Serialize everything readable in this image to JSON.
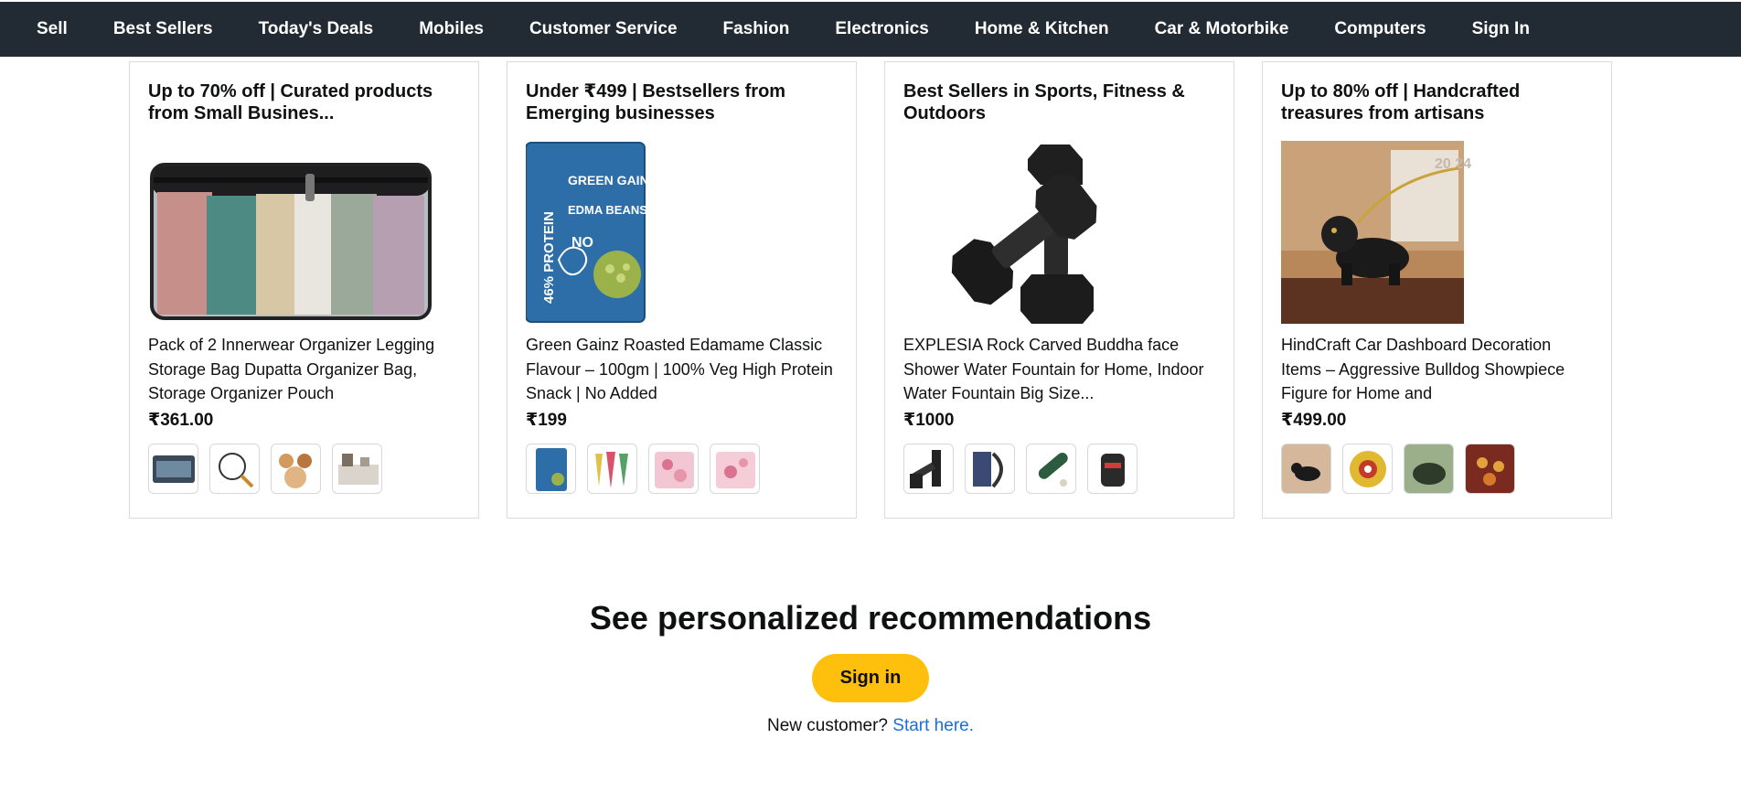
{
  "nav": {
    "items": [
      "Sell",
      "Best Sellers",
      "Today's Deals",
      "Mobiles",
      "Customer Service",
      "Fashion",
      "Electronics",
      "Home & Kitchen",
      "Car & Motorbike",
      "Computers",
      "Sign In"
    ]
  },
  "cards": [
    {
      "title": "Up to 70% off | Curated products from Small Busines...",
      "description": "Pack of 2 Innerwear Organizer Legging Storage Bag Dupatta Organizer Bag, Storage Organizer Pouch",
      "price": "₹361.00",
      "image_icon": "organizer-bag-image"
    },
    {
      "title": "Under ₹499 | Bestsellers from Emerging businesses",
      "description": "Green Gainz Roasted Edamame Classic Flavour – 100gm | 100% Veg High Protein Snack | No Added",
      "price": "₹199",
      "image_icon": "edamame-pack-image",
      "pack_brand": "GREEN GAINZ",
      "pack_name": "EDMA BEANS",
      "pack_side": "46% PROTEIN",
      "pack_no": "NO"
    },
    {
      "title": "Best Sellers in Sports, Fitness & Outdoors",
      "description": "EXPLESIA Rock Carved Buddha face Shower Water Fountain for Home, Indoor Water Fountain Big Size...",
      "price": "₹1000",
      "image_icon": "dumbbells-image"
    },
    {
      "title": "Up to 80% off | Handcrafted treasures from artisans",
      "description": "HindCraft Car Dashboard Decoration Items – Aggressive Bulldog Showpiece Figure for Home and",
      "price": "₹499.00",
      "image_icon": "bulldog-figure-image",
      "corner_text": "20 24"
    }
  ],
  "reco": {
    "title": "See personalized recommendations",
    "button": "Sign in",
    "new_customer": "New customer?",
    "start_link": "Start here."
  },
  "colors": {
    "nav_bg": "#222a33",
    "signin_button": "#ffc00d",
    "link": "#1a6ed8"
  }
}
